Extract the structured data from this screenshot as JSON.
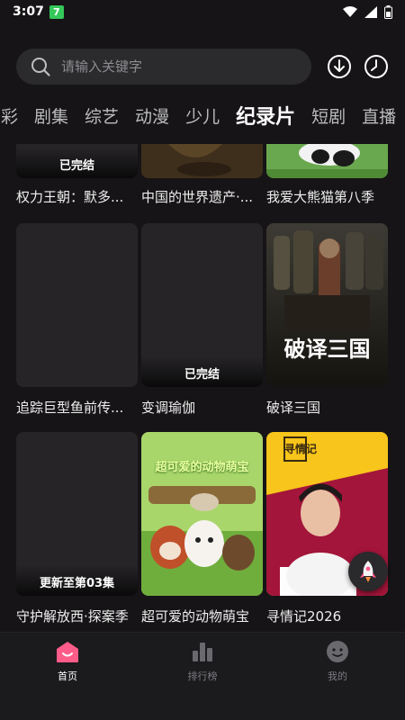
{
  "status": {
    "time": "3:07",
    "badge": "7"
  },
  "search": {
    "placeholder": "请输入关键字"
  },
  "tabs": [
    {
      "label": "彩"
    },
    {
      "label": "剧集"
    },
    {
      "label": "综艺"
    },
    {
      "label": "动漫"
    },
    {
      "label": "少儿"
    },
    {
      "label": "纪录片"
    },
    {
      "label": "短剧"
    },
    {
      "label": "直播"
    }
  ],
  "active_tab": "纪录片",
  "cards": [
    {
      "title": "权力王朝：默多...",
      "badge": "已完结"
    },
    {
      "title": "中国的世界遗产·...",
      "badge": ""
    },
    {
      "title": "我爱大熊猫第八季",
      "badge": ""
    },
    {
      "title": "追踪巨型鱼前传...",
      "badge": ""
    },
    {
      "title": "变调瑜伽",
      "badge": "已完结"
    },
    {
      "title": "破译三国",
      "badge": "",
      "poster_text": "破译三国"
    },
    {
      "title": "守护解放西·探案季",
      "badge": "更新至第03集"
    },
    {
      "title": "超可爱的动物萌宝",
      "badge": "",
      "poster_text": "超可爱的动物萌宝"
    },
    {
      "title": "寻情记2026",
      "badge": "",
      "poster_text": "寻情记"
    }
  ],
  "bottom_nav": [
    {
      "label": "首页"
    },
    {
      "label": "排行榜"
    },
    {
      "label": "我的"
    }
  ],
  "colors": {
    "accent": "#ff5c8a",
    "background": "#161416"
  }
}
